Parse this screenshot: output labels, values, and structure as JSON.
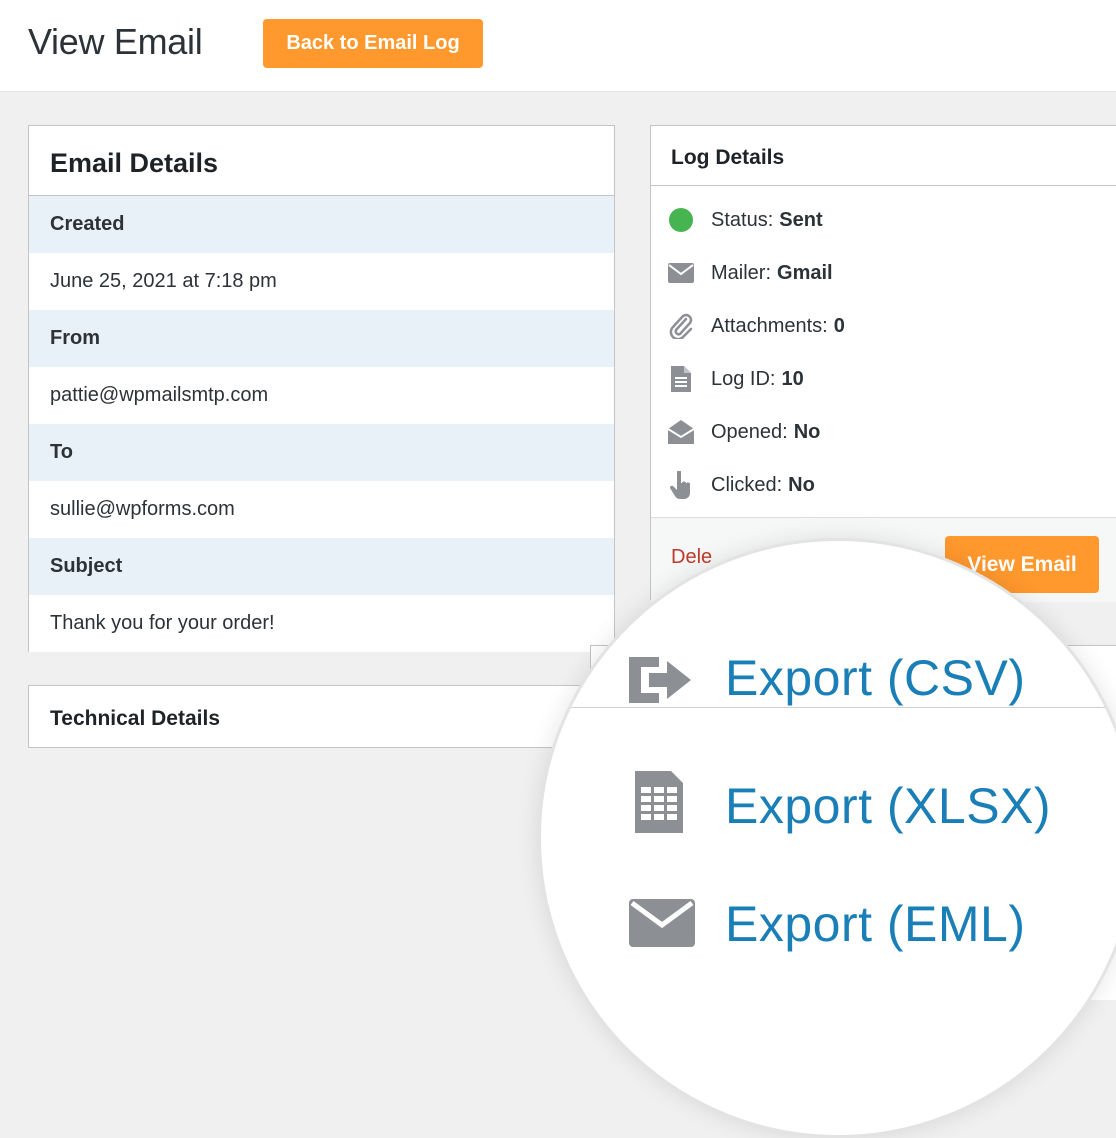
{
  "header": {
    "title": "View Email",
    "back_button": "Back to Email Log"
  },
  "email_details": {
    "title": "Email Details",
    "rows": [
      {
        "label": "Created",
        "value": "June 25, 2021 at 7:18 pm"
      },
      {
        "label": "From",
        "value": "pattie@wpmailsmtp.com"
      },
      {
        "label": "To",
        "value": "sullie@wpforms.com"
      },
      {
        "label": "Subject",
        "value": "Thank you for your order!"
      }
    ]
  },
  "technical_details": {
    "title": "Technical Details"
  },
  "log_details": {
    "title": "Log Details",
    "items": [
      {
        "icon": "status-dot-icon",
        "label": "Status:",
        "value": "Sent"
      },
      {
        "icon": "envelope-icon",
        "label": "Mailer:",
        "value": "Gmail"
      },
      {
        "icon": "paperclip-icon",
        "label": "Attachments:",
        "value": "0"
      },
      {
        "icon": "document-icon",
        "label": "Log ID:",
        "value": "10"
      },
      {
        "icon": "opened-envelope-icon",
        "label": "Opened:",
        "value": "No"
      },
      {
        "icon": "pointer-hand-icon",
        "label": "Clicked:",
        "value": "No"
      }
    ],
    "delete_label": "Dele",
    "view_button": "View Email",
    "status_color": "#46b450"
  },
  "export_actions": [
    {
      "icon": "export-arrow-icon",
      "label": "Export (CSV)"
    },
    {
      "icon": "spreadsheet-icon",
      "label": "Export (XLSX)"
    },
    {
      "icon": "envelope-icon",
      "label": "Export (EML)"
    }
  ],
  "colors": {
    "accent": "#ff982d",
    "link": "#1a7fb7",
    "delete": "#c0392b",
    "label_row_bg": "#e8f0f8"
  }
}
